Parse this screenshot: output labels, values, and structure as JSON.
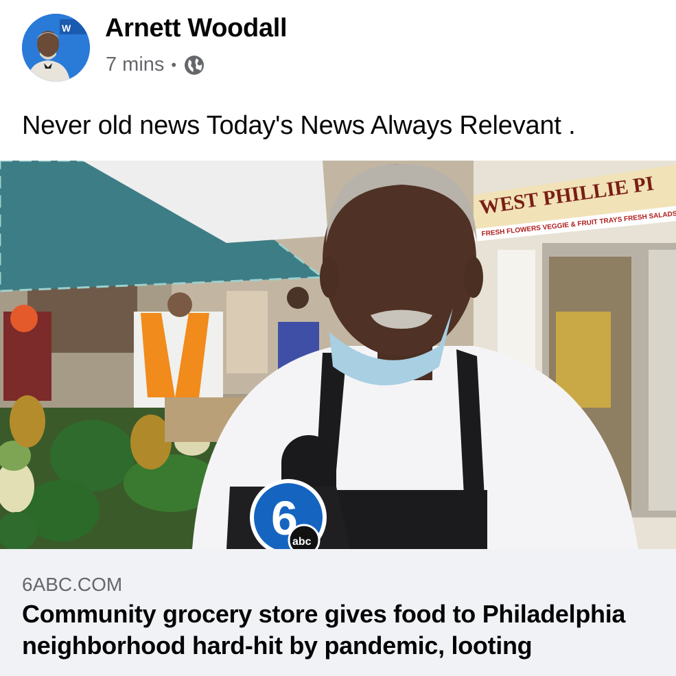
{
  "post": {
    "author": "Arnett Woodall",
    "time": "7 mins",
    "separator": "•",
    "privacy_icon": "globe-icon",
    "text": "Never old news Today's News Always Relevant ."
  },
  "link_preview": {
    "image_alt": "Man in white shirt and apron being interviewed in front of produce stand and West Phillie storefront",
    "sign_text": "WEST PHILLIE PI",
    "sign_subtext": "FRESH FLOWERS VEGGIE & FRUIT TRAYS FRESH SALADS",
    "domain": "6ABC.COM",
    "headline": "Community grocery store gives food to Philadelphia\nneighborhood hard-hit by pandemic, looting",
    "logo_text": "abc",
    "logo_number": "6"
  },
  "colors": {
    "author": "#050505",
    "meta": "#65676b",
    "preview_bg": "#f0f2f5",
    "avatar_bg": "#1d6fd1"
  }
}
